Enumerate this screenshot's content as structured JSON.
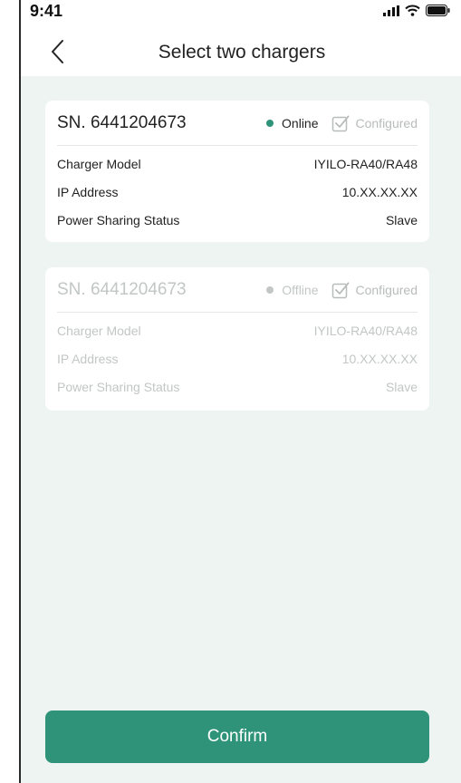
{
  "status_bar": {
    "time": "9:41"
  },
  "header": {
    "title": "Select two chargers"
  },
  "chargers": [
    {
      "sn": "SN. 6441204673",
      "status": "Online",
      "configured_label": "Configured",
      "rows": [
        {
          "label": "Charger Model",
          "value": "IYILO-RA40/RA48"
        },
        {
          "label": "IP Address",
          "value": "10.XX.XX.XX"
        },
        {
          "label": "Power Sharing Status",
          "value": "Slave"
        }
      ]
    },
    {
      "sn": "SN. 6441204673",
      "status": "Offline",
      "configured_label": "Configured",
      "rows": [
        {
          "label": "Charger Model",
          "value": "IYILO-RA40/RA48"
        },
        {
          "label": "IP Address",
          "value": "10.XX.XX.XX"
        },
        {
          "label": "Power Sharing Status",
          "value": "Slave"
        }
      ]
    }
  ],
  "confirm_label": "Confirm",
  "colors": {
    "accent": "#2e9378",
    "online_dot": "#2e9378",
    "offline_dot": "#c2c6c5",
    "background": "#eef4f1"
  },
  "icons": {
    "back": "chevron-left-icon",
    "signal": "cellular-signal-icon",
    "wifi": "wifi-icon",
    "battery": "battery-icon",
    "configured": "checkbox-checked-icon"
  }
}
